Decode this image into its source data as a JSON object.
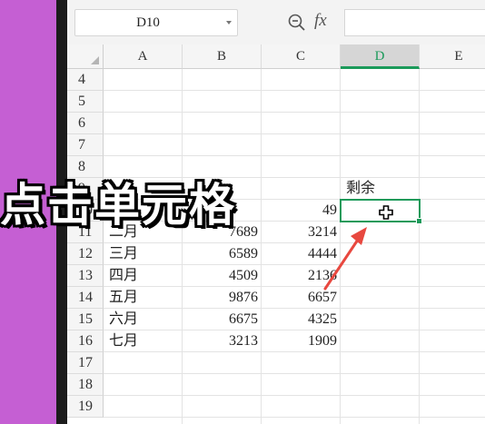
{
  "formula_bar": {
    "name_box": "D10",
    "fx_label": "fx",
    "formula": ""
  },
  "columns": [
    "A",
    "B",
    "C",
    "D",
    "E"
  ],
  "selected_column": "D",
  "rows": [
    "4",
    "5",
    "6",
    "7",
    "8",
    "9",
    "10",
    "11",
    "12",
    "13",
    "14",
    "15",
    "16",
    "17",
    "18",
    "19"
  ],
  "visible_cells": [
    {
      "ref": "D9",
      "value": "剩余"
    },
    {
      "ref": "C10",
      "value": "49"
    },
    {
      "ref": "A11",
      "value": "二月"
    },
    {
      "ref": "B11",
      "value": "7689"
    },
    {
      "ref": "C11",
      "value": "3214"
    },
    {
      "ref": "A12",
      "value": "三月"
    },
    {
      "ref": "B12",
      "value": "6589"
    },
    {
      "ref": "C12",
      "value": "4444"
    },
    {
      "ref": "A13",
      "value": "四月"
    },
    {
      "ref": "B13",
      "value": "4509"
    },
    {
      "ref": "C13",
      "value": "2136"
    },
    {
      "ref": "A14",
      "value": "五月"
    },
    {
      "ref": "B14",
      "value": "9876"
    },
    {
      "ref": "C14",
      "value": "6657"
    },
    {
      "ref": "A15",
      "value": "六月"
    },
    {
      "ref": "B15",
      "value": "6675"
    },
    {
      "ref": "C15",
      "value": "4325"
    },
    {
      "ref": "A16",
      "value": "七月"
    },
    {
      "ref": "B16",
      "value": "3213"
    },
    {
      "ref": "C16",
      "value": "1909"
    }
  ],
  "selected_cell": "D10",
  "overlay_caption": "点击单元格",
  "colors": {
    "background": "#c55fd3",
    "selection": "#1b9a5a",
    "arrow": "#e8483f"
  },
  "icons": [
    "zoom-icon",
    "plus-cursor-icon",
    "dropdown-arrow-icon",
    "select-all-icon"
  ]
}
